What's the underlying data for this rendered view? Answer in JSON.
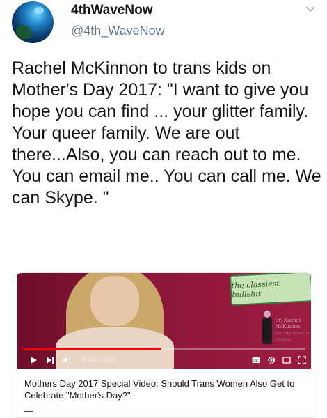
{
  "tweet": {
    "display_name": "4thWaveNow",
    "handle": "@4th_WaveNow",
    "text": "Rachel McKinnon to trans kids on Mother's Day 2017: \"I want to give you hope you can find ... your glitter family. Your queer family. We are out there...Also, you can reach out to me. You can email me.. You can call me. We can Skype. \""
  },
  "card": {
    "banner_text": "the classiest bullshit",
    "overlay_name": "Dr. Rachel McKinnon",
    "overlay_sub": "Making smarter choices",
    "video_time": "6:03 / 12:20",
    "progress_fraction": 0.49,
    "title": "Mothers Day 2017 Special Video: Should Trans Women Also Get to Celebrate \"Mother's Day?\""
  },
  "icons": {
    "caret": "chevron-down-icon",
    "play": "play-icon",
    "next": "next-icon",
    "volume": "volume-icon",
    "cc": "captions-icon",
    "settings": "gear-icon",
    "miniplayer": "miniplayer-icon",
    "fullscreen": "fullscreen-icon"
  },
  "colors": {
    "text": "#14171a",
    "secondary": "#657786",
    "video_bg": "#8d1638",
    "progress": "#ff0000"
  }
}
